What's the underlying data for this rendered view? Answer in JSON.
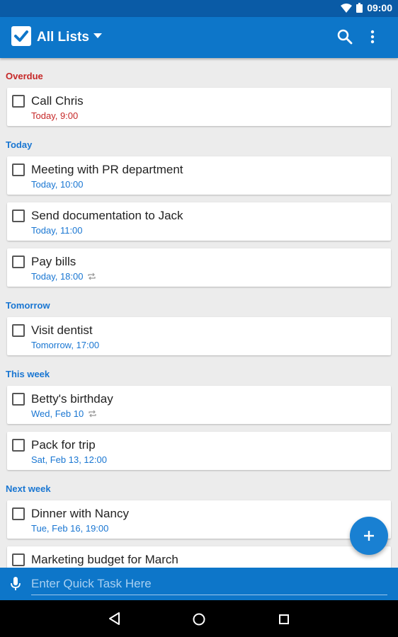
{
  "status_bar": {
    "time": "09:00"
  },
  "app_bar": {
    "title": "All Lists"
  },
  "colors": {
    "primary": "#0d76c9",
    "overdue": "#c62828",
    "due": "#1976d2",
    "fab": "#1980d2"
  },
  "sections": [
    {
      "label": "Overdue",
      "tasks": [
        {
          "title": "Call Chris",
          "due": "Today, 9:00",
          "repeat": false
        }
      ]
    },
    {
      "label": "Today",
      "tasks": [
        {
          "title": "Meeting with PR department",
          "due": "Today, 10:00",
          "repeat": false
        },
        {
          "title": "Send documentation to Jack",
          "due": "Today, 11:00",
          "repeat": false
        },
        {
          "title": "Pay bills",
          "due": "Today, 18:00",
          "repeat": true
        }
      ]
    },
    {
      "label": "Tomorrow",
      "tasks": [
        {
          "title": "Visit dentist",
          "due": "Tomorrow, 17:00",
          "repeat": false
        }
      ]
    },
    {
      "label": "This week",
      "tasks": [
        {
          "title": "Betty's birthday",
          "due": "Wed, Feb 10",
          "repeat": true
        },
        {
          "title": "Pack for trip",
          "due": "Sat, Feb 13, 12:00",
          "repeat": false
        }
      ]
    },
    {
      "label": "Next week",
      "tasks": [
        {
          "title": "Dinner with Nancy",
          "due": "Tue, Feb 16, 19:00",
          "repeat": false
        },
        {
          "title": "Marketing budget for March",
          "due": "",
          "repeat": false
        }
      ]
    }
  ],
  "quick_task": {
    "placeholder": "Enter Quick Task Here",
    "value": ""
  },
  "icons": {
    "app_logo": "checkbox-logo-icon",
    "dropdown": "caret-down-icon",
    "search": "search-icon",
    "menu": "more-vert-icon",
    "repeat": "repeat-icon",
    "fab": "plus-icon",
    "mic": "mic-icon",
    "nav_back": "back-triangle-icon",
    "nav_home": "home-circle-icon",
    "nav_recent": "recent-square-icon"
  }
}
